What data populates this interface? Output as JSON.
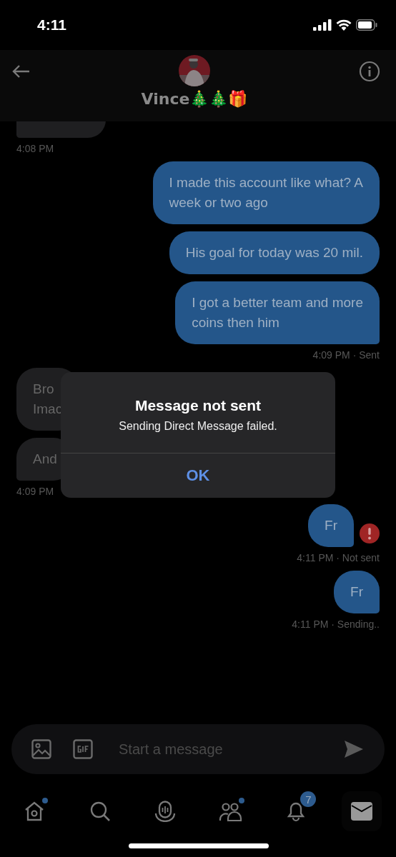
{
  "status_bar": {
    "time": "4:11"
  },
  "header": {
    "name": "Vince🎄🎄🎁"
  },
  "groups": [
    {
      "kind": "received",
      "failed": false,
      "bubbles": [
        {
          "kind": "partial"
        }
      ],
      "meta": "4:08 PM"
    },
    {
      "kind": "sent",
      "failed": false,
      "bubbles": [
        {
          "kind": "text",
          "lines": [
            "I made this account like what? A",
            "week or two ago"
          ]
        },
        {
          "kind": "text",
          "lines": [
            "His goal for today was 20 mil."
          ]
        },
        {
          "kind": "text",
          "lines": [
            "I got a better team and more",
            "coins then him"
          ]
        }
      ],
      "meta": "4:09 PM · Sent"
    },
    {
      "kind": "received",
      "failed": false,
      "bubbles": [
        {
          "kind": "text",
          "lines": [
            "Bro",
            "Imac"
          ]
        },
        {
          "kind": "text",
          "lines": [
            "And"
          ]
        }
      ],
      "meta": "4:09 PM"
    },
    {
      "kind": "sent",
      "failed": true,
      "bubbles": [
        {
          "kind": "text",
          "lines": [
            "Fr"
          ]
        }
      ],
      "meta": "4:11 PM · Not sent"
    },
    {
      "kind": "sent",
      "failed": false,
      "bubbles": [
        {
          "kind": "text",
          "lines": [
            "Fr"
          ]
        }
      ],
      "meta": "4:11 PM · Sending.."
    }
  ],
  "alert": {
    "title": "Message not sent",
    "message": "Sending Direct Message failed.",
    "button": "OK"
  },
  "composer": {
    "placeholder": "Start a message"
  },
  "tabs": [
    {
      "kind": "home",
      "selected": false,
      "dot": true
    },
    {
      "kind": "search",
      "selected": false,
      "dot": false
    },
    {
      "kind": "spaces",
      "selected": false,
      "dot": false
    },
    {
      "kind": "communities",
      "selected": false,
      "dot": true
    },
    {
      "kind": "notifications",
      "selected": false,
      "dot": false,
      "badge": "7"
    },
    {
      "kind": "messages",
      "selected": true,
      "dot": false
    }
  ]
}
